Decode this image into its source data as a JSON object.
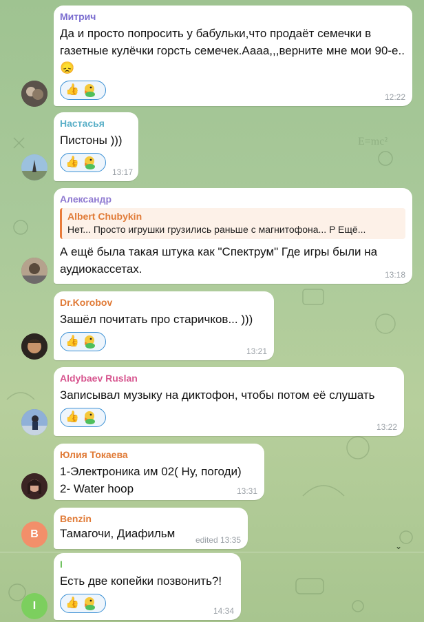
{
  "messages": [
    {
      "author": "Митрич",
      "author_color": "#7a6ccf",
      "text": "Да и просто попросить у бабульки,что продаёт семечки в газетные кулёчки горсть семечек.Аааа,,,верните мне мои 90-е..😞",
      "time": "12:22",
      "reactions": [
        "👍",
        "duck"
      ]
    },
    {
      "author": "Настасья",
      "author_color": "#5bb0c8",
      "text": "Пистоны )))",
      "time": "13:17",
      "reactions": [
        "👍",
        "duck"
      ]
    },
    {
      "author": "Александр",
      "author_color": "#8f7ad1",
      "reply_author": "Albert Chubykin",
      "reply_text": "Нет... Просто игрушки грузились раньше с магнитофона... P Ещё...",
      "text": "А ещё была такая штука как \"Спектрум\" Где игры были на аудиокассетах.",
      "time": "13:18"
    },
    {
      "author": "Dr.Korobov",
      "author_color": "#e07a36",
      "text": "Зашёл почитать про старичков... )))",
      "time": "13:21",
      "reactions": [
        "👍",
        "duck"
      ]
    },
    {
      "author": "Aldybaev Ruslan",
      "author_color": "#d7568f",
      "text": "Записывал музыку на диктофон, чтобы потом её слушать",
      "time": "13:22",
      "reactions": [
        "👍",
        "duck"
      ]
    },
    {
      "author": "Юлия Токаева",
      "author_color": "#e07a36",
      "text_line1": "1-Электроника им 02( Ну, погоди)",
      "text_line2": "2- Water hoop",
      "time": "13:31"
    },
    {
      "author": "Benzin",
      "author_color": "#e07a36",
      "avatar_letter": "B",
      "avatar_color": "#f28f6a",
      "text": "Тамагочи, Диафильм",
      "time": "edited 13:35"
    },
    {
      "author": "I",
      "author_color": "#6cbf5b",
      "avatar_letter": "I",
      "avatar_color": "#7ccf5e",
      "text": "Есть две копейки позвонить?!",
      "time": "14:34",
      "reactions": [
        "👍",
        "duck"
      ]
    }
  ]
}
